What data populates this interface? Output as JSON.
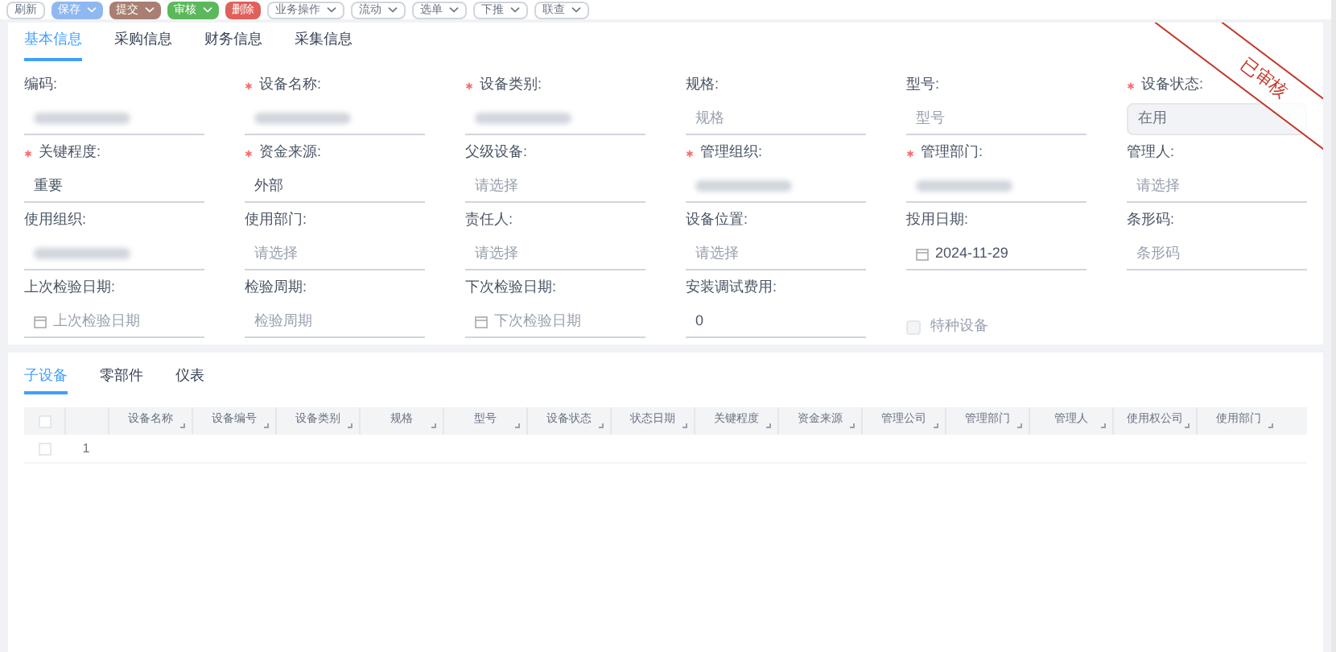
{
  "toolbar": [
    {
      "label": "刷新",
      "kind": "plain",
      "split": false
    },
    {
      "label": "保存",
      "kind": "blue",
      "split": true
    },
    {
      "label": "提交",
      "kind": "brown",
      "split": true
    },
    {
      "label": "审核",
      "kind": "green",
      "split": true
    },
    {
      "label": "删除",
      "kind": "red",
      "split": false
    },
    {
      "label": "业务操作",
      "kind": "plain",
      "split": true
    },
    {
      "label": "流动",
      "kind": "plain",
      "split": true
    },
    {
      "label": "选单",
      "kind": "plain",
      "split": true
    },
    {
      "label": "下推",
      "kind": "plain",
      "split": true
    },
    {
      "label": "联查",
      "kind": "plain",
      "split": true
    }
  ],
  "form_tabs": [
    {
      "label": "基本信息",
      "selected": true
    },
    {
      "label": "采购信息",
      "selected": false
    },
    {
      "label": "财务信息",
      "selected": false
    },
    {
      "label": "采集信息",
      "selected": false
    }
  ],
  "stamp": "已审核",
  "fields": [
    {
      "label": "编码:",
      "required": false,
      "kind": "redacted"
    },
    {
      "label": "设备名称:",
      "required": true,
      "kind": "redacted"
    },
    {
      "label": "设备类别:",
      "required": true,
      "kind": "redacted"
    },
    {
      "label": "规格:",
      "required": false,
      "kind": "text",
      "placeholder": "规格"
    },
    {
      "label": "型号:",
      "required": false,
      "kind": "text",
      "placeholder": "型号"
    },
    {
      "label": "设备状态:",
      "required": true,
      "kind": "text",
      "value": "在用",
      "disabled": true
    },
    {
      "label": "关键程度:",
      "required": true,
      "kind": "text",
      "value": "重要"
    },
    {
      "label": "资金来源:",
      "required": true,
      "kind": "text",
      "value": "外部"
    },
    {
      "label": "父级设备:",
      "required": false,
      "kind": "text",
      "placeholder": "请选择"
    },
    {
      "label": "管理组织:",
      "required": true,
      "kind": "redacted"
    },
    {
      "label": "管理部门:",
      "required": true,
      "kind": "redacted"
    },
    {
      "label": "管理人:",
      "required": false,
      "kind": "text",
      "placeholder": "请选择"
    },
    {
      "label": "使用组织:",
      "required": false,
      "kind": "redacted"
    },
    {
      "label": "使用部门:",
      "required": false,
      "kind": "text",
      "placeholder": "请选择"
    },
    {
      "label": "责任人:",
      "required": false,
      "kind": "text",
      "placeholder": "请选择"
    },
    {
      "label": "设备位置:",
      "required": false,
      "kind": "text",
      "placeholder": "请选择"
    },
    {
      "label": "投用日期:",
      "required": false,
      "kind": "date",
      "value": "2024-11-29"
    },
    {
      "label": "条形码:",
      "required": false,
      "kind": "text",
      "placeholder": "条形码"
    },
    {
      "label": "上次检验日期:",
      "required": false,
      "kind": "date",
      "placeholder": "上次检验日期"
    },
    {
      "label": "检验周期:",
      "required": false,
      "kind": "text",
      "placeholder": "检验周期"
    },
    {
      "label": "下次检验日期:",
      "required": false,
      "kind": "date",
      "placeholder": "下次检验日期"
    },
    {
      "label": "安装调试费用:",
      "required": false,
      "kind": "text",
      "value": "0"
    },
    {
      "label": "特种设备",
      "kind": "checkbox",
      "checked": false
    }
  ],
  "detail_tabs": [
    {
      "label": "子设备",
      "selected": true
    },
    {
      "label": "零部件",
      "selected": false
    },
    {
      "label": "仪表",
      "selected": false
    }
  ],
  "table": {
    "header_checked": false,
    "columns": [
      "设备名称",
      "设备编号",
      "设备类别",
      "规格",
      "型号",
      "设备状态",
      "状态日期",
      "关键程度",
      "资金来源",
      "管理公司",
      "管理部门",
      "管理人",
      "使用权公司",
      "使用部门"
    ],
    "rows": [
      {
        "index": "1",
        "checked": false
      }
    ]
  }
}
